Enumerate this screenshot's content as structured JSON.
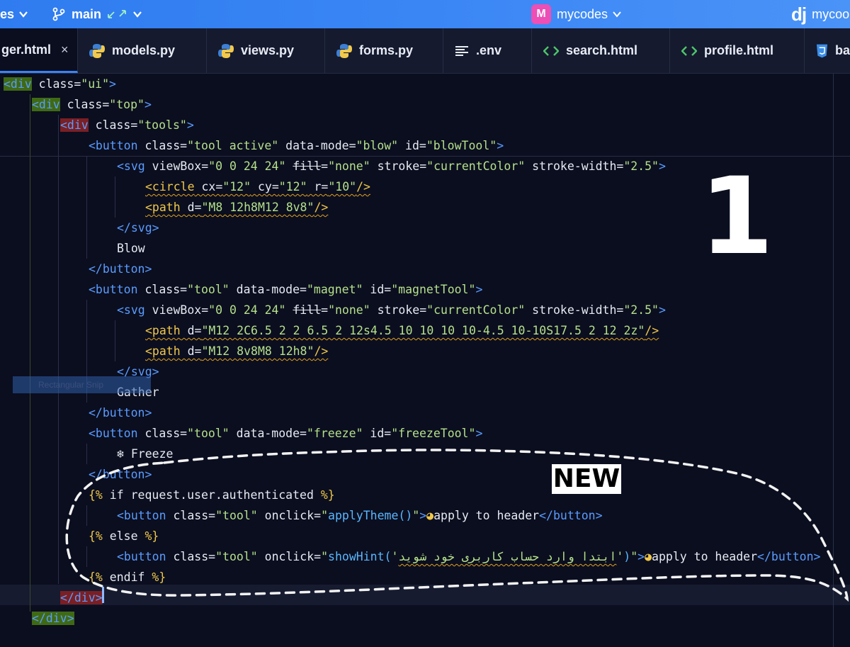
{
  "topbar": {
    "project_partial": "es",
    "branch": "main",
    "repo_badge": "M",
    "repo": "mycodes",
    "dj_logo": "dj",
    "dj_label": "mycoo"
  },
  "tabs": [
    {
      "label": "ger.html",
      "icon": "html-icon",
      "active": true
    },
    {
      "label": "models.py",
      "icon": "python-icon"
    },
    {
      "label": "views.py",
      "icon": "python-icon"
    },
    {
      "label": "forms.py",
      "icon": "python-icon"
    },
    {
      "label": ".env",
      "icon": "env-icon"
    },
    {
      "label": "search.html",
      "icon": "html-icon"
    },
    {
      "label": "profile.html",
      "icon": "html-icon"
    },
    {
      "label": "ba",
      "icon": "css-icon"
    }
  ],
  "tab_close": "×",
  "code_lines": [
    [
      [
        "hl-green tg",
        "<div"
      ],
      [
        "at",
        " class="
      ],
      [
        "st",
        "\"ui\""
      ],
      [
        "tg",
        ">"
      ]
    ],
    [
      [
        "hl-green tg",
        "<div"
      ],
      [
        "at",
        " class="
      ],
      [
        "st",
        "\"top\""
      ],
      [
        "tg",
        ">"
      ]
    ],
    [
      [
        "hl-red tg",
        "<div"
      ],
      [
        "at",
        " class="
      ],
      [
        "st",
        "\"tools\""
      ],
      [
        "tg",
        ">"
      ]
    ],
    [
      [
        "tg",
        "<button"
      ],
      [
        "at",
        " class="
      ],
      [
        "st",
        "\"tool active\""
      ],
      [
        "at",
        " data-mode="
      ],
      [
        "st",
        "\"blow\""
      ],
      [
        "at",
        " id="
      ],
      [
        "st",
        "\"blowTool\""
      ],
      [
        "tg",
        ">"
      ]
    ],
    [
      [
        "tg",
        "<svg"
      ],
      [
        "at",
        " viewBox="
      ],
      [
        "st",
        "\"0 0 24 24\""
      ],
      [
        "at",
        " "
      ],
      [
        "at strike",
        "fill"
      ],
      [
        "at",
        "="
      ],
      [
        "st",
        "\"none\""
      ],
      [
        "at",
        " stroke="
      ],
      [
        "st",
        "\"currentColor\""
      ],
      [
        "at",
        " stroke-width="
      ],
      [
        "st",
        "\"2.5\""
      ],
      [
        "tg",
        ">"
      ]
    ],
    [
      [
        "pu sq",
        "<circle"
      ],
      [
        "at sq",
        " cx="
      ],
      [
        "st sq",
        "\"12\""
      ],
      [
        "at sq",
        " cy="
      ],
      [
        "st sq",
        "\"12\""
      ],
      [
        "at sq",
        " r="
      ],
      [
        "st sq",
        "\"10\""
      ],
      [
        "pu sq",
        "/>"
      ]
    ],
    [
      [
        "pu sq",
        "<path"
      ],
      [
        "at sq",
        " d="
      ],
      [
        "st sq",
        "\"M8 12h8M12 8v8\""
      ],
      [
        "pu sq",
        "/>"
      ]
    ],
    [
      [
        "tg",
        "</svg>"
      ]
    ],
    [
      [
        "at",
        "Blow"
      ]
    ],
    [
      [
        "tg",
        "</button>"
      ]
    ],
    [
      [
        "tg",
        "<button"
      ],
      [
        "at",
        " class="
      ],
      [
        "st",
        "\"tool\""
      ],
      [
        "at",
        " data-mode="
      ],
      [
        "st",
        "\"magnet\""
      ],
      [
        "at",
        " id="
      ],
      [
        "st",
        "\"magnetTool\""
      ],
      [
        "tg",
        ">"
      ]
    ],
    [
      [
        "tg",
        "<svg"
      ],
      [
        "at",
        " viewBox="
      ],
      [
        "st",
        "\"0 0 24 24\""
      ],
      [
        "at",
        " "
      ],
      [
        "at strike",
        "fill"
      ],
      [
        "at",
        "="
      ],
      [
        "st",
        "\"none\""
      ],
      [
        "at",
        " stroke="
      ],
      [
        "st",
        "\"currentColor\""
      ],
      [
        "at",
        " stroke-width="
      ],
      [
        "st",
        "\"2.5\""
      ],
      [
        "tg",
        ">"
      ]
    ],
    [
      [
        "pu sq",
        "<path"
      ],
      [
        "at sq",
        " d="
      ],
      [
        "st sq",
        "\"M12 2C6.5 2 2 6.5 2 12s4.5 10 10 10 10-4.5 10-10S17.5 2 12 2z\""
      ],
      [
        "pu sq",
        "/>"
      ]
    ],
    [
      [
        "pu sq",
        "<path"
      ],
      [
        "at sq",
        " d="
      ],
      [
        "st sq",
        "\"M12 8v8M8 12h8\""
      ],
      [
        "pu sq",
        "/>"
      ]
    ],
    [
      [
        "tg",
        "</svg>"
      ]
    ],
    [
      [
        "at",
        "Gather"
      ]
    ],
    [
      [
        "tg",
        "</button>"
      ]
    ],
    [
      [
        "tg",
        "<button"
      ],
      [
        "at",
        " class="
      ],
      [
        "st",
        "\"tool\""
      ],
      [
        "at",
        " data-mode="
      ],
      [
        "st",
        "\"freeze\""
      ],
      [
        "at",
        " id="
      ],
      [
        "st",
        "\"freezeTool\""
      ],
      [
        "tg",
        ">"
      ]
    ],
    [
      [
        "at",
        "❄ Freeze"
      ]
    ],
    [
      [
        "tg",
        "</button>"
      ]
    ],
    [
      [
        "tmp",
        "{%"
      ],
      [
        "at",
        " if request.user.authenticated "
      ],
      [
        "tmp",
        "%}"
      ]
    ],
    [
      [
        "tg",
        "<button"
      ],
      [
        "at",
        " class="
      ],
      [
        "st",
        "\"tool\""
      ],
      [
        "at",
        " onclick="
      ],
      [
        "st",
        "\""
      ],
      [
        "fn",
        "applyTheme()"
      ],
      [
        "st",
        "\""
      ],
      [
        "tg",
        ">"
      ],
      [
        "pu",
        "◕"
      ],
      [
        "at",
        "apply to header"
      ],
      [
        "tg",
        "</button>"
      ]
    ],
    [
      [
        "tmp",
        "{%"
      ],
      [
        "at",
        " else "
      ],
      [
        "tmp",
        "%}"
      ]
    ],
    [
      [
        "tg",
        "<button"
      ],
      [
        "at",
        " class="
      ],
      [
        "st",
        "\"tool\""
      ],
      [
        "at",
        " onclick="
      ],
      [
        "st",
        "\""
      ],
      [
        "fn",
        "showHint("
      ],
      [
        "st",
        "'"
      ],
      [
        "st sq",
        "ابتدا وارد حساب کاربری خود شوید"
      ],
      [
        "st",
        "'"
      ],
      [
        "fn",
        ")"
      ],
      [
        "st",
        "\""
      ],
      [
        "tg",
        ">"
      ],
      [
        "pu",
        "◕"
      ],
      [
        "at",
        "apply to header"
      ],
      [
        "tg",
        "</button>"
      ]
    ],
    [
      [
        "tmp",
        "{%"
      ],
      [
        "at",
        " endif "
      ],
      [
        "tmp",
        "%}"
      ]
    ],
    [
      [
        "hl-red tg",
        "</div>"
      ]
    ],
    [
      [
        "hl-green tg",
        "</div>"
      ]
    ]
  ],
  "snip_label": "Rectangular Snip",
  "overlay": {
    "number": "1",
    "new_label": "NEW"
  }
}
